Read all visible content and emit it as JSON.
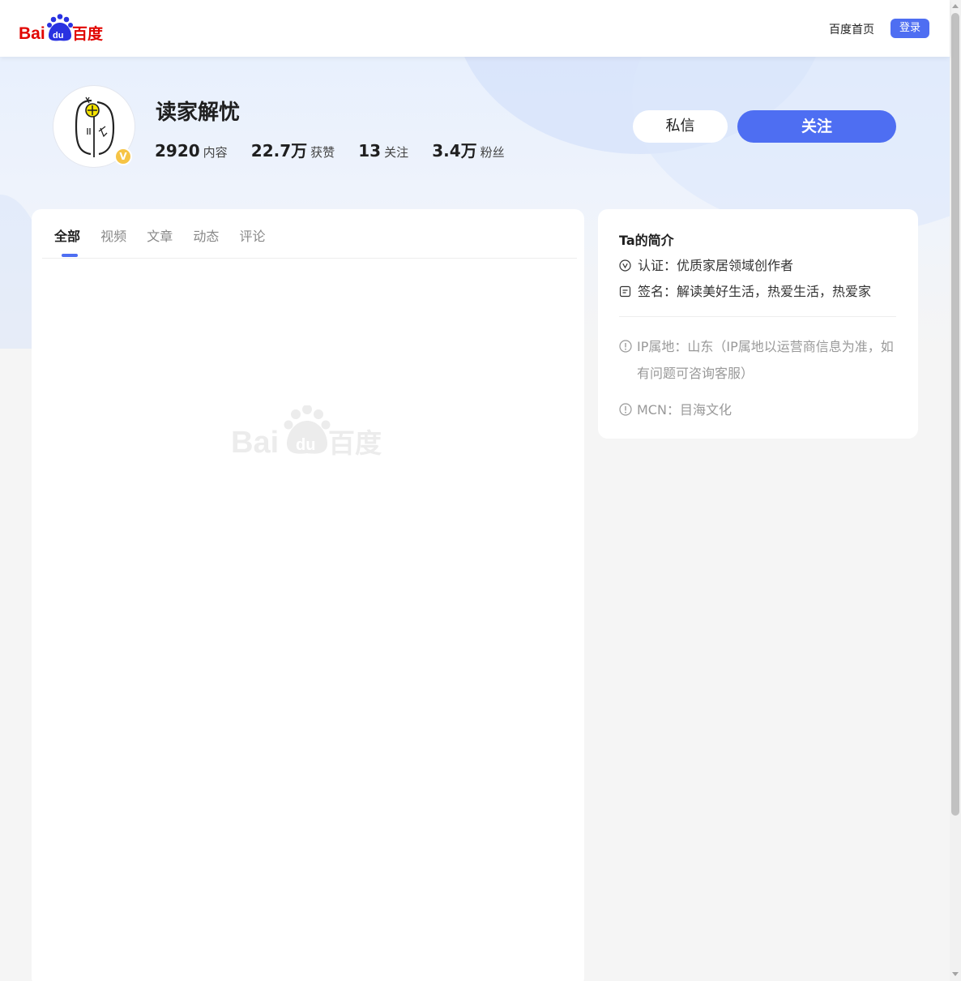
{
  "header": {
    "logo_alt": "Baidu百度",
    "home_link": "百度首页",
    "login_button": "登录"
  },
  "profile": {
    "name": "读家解忧",
    "stats": [
      {
        "value": "2920",
        "label": "内容"
      },
      {
        "value": "22.7万",
        "label": "获赞"
      },
      {
        "value": "13",
        "label": "关注"
      },
      {
        "value": "3.4万",
        "label": "粉丝"
      }
    ],
    "verified_badge": "V",
    "message_button": "私信",
    "follow_button": "关注"
  },
  "tabs": [
    {
      "label": "全部",
      "active": true
    },
    {
      "label": "视频",
      "active": false
    },
    {
      "label": "文章",
      "active": false
    },
    {
      "label": "动态",
      "active": false
    },
    {
      "label": "评论",
      "active": false
    }
  ],
  "intro": {
    "title": "Ta的简介",
    "certification": "认证：优质家居领域创作者",
    "signature": "签名：解读美好生活，热爱生活，热爱家",
    "ip_location": "IP属地：山东（IP属地以运营商信息为准，如有问题可咨询客服）",
    "mcn": "MCN：目海文化"
  },
  "colors": {
    "accent": "#4e6ef2",
    "badge": "#f6c445",
    "logo_red": "#e10602",
    "logo_blue": "#2932e1"
  }
}
